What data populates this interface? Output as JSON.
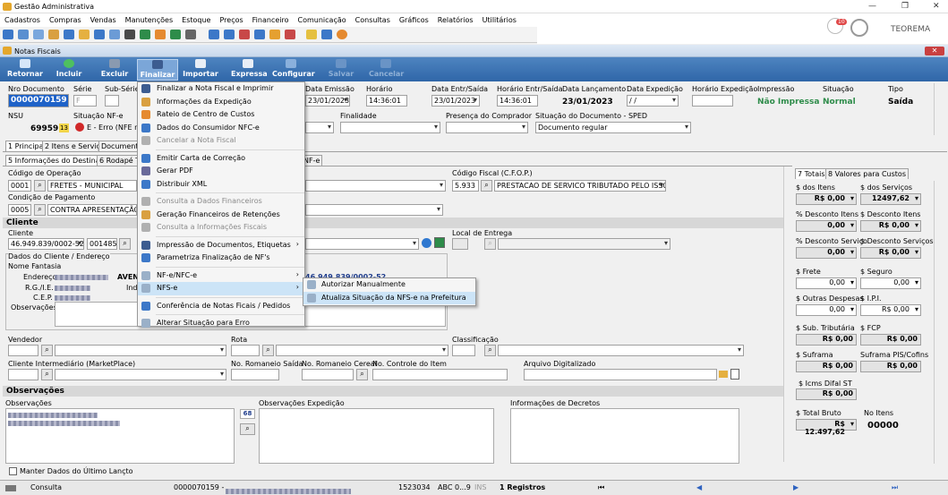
{
  "app": {
    "title": "Gestão Administrativa",
    "user": "TEOREMA",
    "notif_count": "10"
  },
  "menubar": [
    "Cadastros",
    "Compras",
    "Vendas",
    "Manutenções",
    "Estoque",
    "Preços",
    "Financeiro",
    "Comunicação",
    "Consultas",
    "Gráficos",
    "Relatórios",
    "Utilitários",
    "Ajuda",
    "Janelas"
  ],
  "window": {
    "title": "Notas Fiscais"
  },
  "ribbon": {
    "retornar": "Retornar",
    "incluir": "Incluir",
    "excluir": "Excluir",
    "finalizar": "Finalizar",
    "importar": "Importar",
    "expressa": "Expressa",
    "configurar": "Configurar",
    "salvar": "Salvar",
    "cancelar": "Cancelar"
  },
  "header": {
    "nro_label": "Nro Documento",
    "nro": "0000070159",
    "serie_label": "Série",
    "serie": "F",
    "subserie_label": "Sub-Série",
    "emissao_label": "Data Emissão",
    "emissao": "23/01/2023",
    "hora_label": "Horário",
    "hora": "14:36:01",
    "entrada_label": "Data Entr/Saída",
    "entrada": "23/01/2023",
    "hora_es_label": "Horário Entr/Saída",
    "hora_es": "14:36:01",
    "lanc_label": "Data Lançamento",
    "lanc": "23/01/2023",
    "exped_label": "Data Expedição",
    "exped": "/ /",
    "hora_exp_label": "Horário Expedição",
    "impressao_label": "Impressão",
    "impressao": "Não Impressa",
    "situacao_label": "Situação",
    "situacao": "Normal",
    "tipo_label": "Tipo",
    "tipo": "Saída",
    "nsu_label": "NSU",
    "nsu": "69959",
    "nsu_badge": "13",
    "sitnfe_label": "Situação NF-e",
    "sitnfe": "E - Erro (NFE nã",
    "finalidade_label": "Finalidade",
    "presenca_label": "Presença do Comprador",
    "sitdoc_label": "Situação do Documento - SPED",
    "sitdoc": "Documento regular"
  },
  "tabs1": [
    "1 Principal",
    "2 Itens e Serviços",
    "Documentos"
  ],
  "tabs2": [
    "5 Informações do Destinatário",
    "6 Rodapé Tra",
    "NF-e"
  ],
  "form": {
    "cod_op_label": "Código de Operação",
    "cod_op": "0001",
    "cod_op_desc": "FRETES - MUNICIPAL",
    "cfop_label": "Código Fiscal (C.F.O.P.)",
    "cfop": "5.933",
    "cfop_desc": "PRESTACAO DE SERVICO TRIBUTADO PELO ISSQN",
    "cond_label": "Condição de Pagamento",
    "cond": "0005",
    "cond_desc": "CONTRA APRESENTAÇÃO",
    "cliente_section": "Cliente",
    "cliente_label": "Cliente",
    "cliente_doc": "46.949.839/0002-52",
    "cliente_cod": "0014857",
    "local_label": "Local de Entrega",
    "dados_label": "Dados do Cliente / Endereço",
    "fantasia_label": "Nome Fantasia",
    "endereco_label": "Endereço",
    "endereco": "AVEN",
    "rg_label": "R.G./I.E.",
    "ind_label": "Ind",
    "cep_label": "C.E.P.",
    "obs_label": "Observações",
    "doc_right": "46.949.839/0002-52",
    "vendedor_label": "Vendedor",
    "rota_label": "Rota",
    "class_label": "Classificação",
    "interm_label": "Cliente Intermediário (MarketPlace)",
    "romaneio_label": "No. Romaneio Saída",
    "romcer_label": "No. Romaneio Cereal",
    "ctrl_label": "No. Controle do Item",
    "arquivo_label": "Arquivo Digitalizado",
    "obs_section": "Observações",
    "obs_col": "Observações",
    "obs_exp_col": "Observações Expedição",
    "decretos_col": "Informações de Decretos",
    "obs_count": "68",
    "manter": "Manter Dados do Último Lançto"
  },
  "finalizar_menu": [
    {
      "label": "Finalizar a Nota Fiscal e Imprimir",
      "dis": false
    },
    {
      "label": "Informações da Expedição",
      "dis": false
    },
    {
      "label": "Rateio de Centro de Custos",
      "dis": false
    },
    {
      "label": "Dados do Consumidor NFC-e",
      "dis": false
    },
    {
      "label": "Cancelar a Nota Fiscal",
      "dis": true
    },
    {
      "label": "Emitir Carta de Correção",
      "dis": false
    },
    {
      "label": "Gerar PDF",
      "dis": false
    },
    {
      "label": "Distribuir XML",
      "dis": false
    },
    {
      "label": "Consulta a Dados Financeiros",
      "dis": true
    },
    {
      "label": "Geração Financeiros de Retenções",
      "dis": false
    },
    {
      "label": "Consulta a Informações Fiscais",
      "dis": true
    },
    {
      "label": "Impressão de Documentos, Etiquetas",
      "dis": false
    },
    {
      "label": "Parametriza Finalização de NF's",
      "dis": false
    },
    {
      "label": "NF-e/NFC-e",
      "dis": false
    },
    {
      "label": "NFS-e",
      "dis": false
    },
    {
      "label": "Conferência de Notas Ficais / Pedidos",
      "dis": false
    },
    {
      "label": "Alterar Situação para Erro",
      "dis": false
    }
  ],
  "nfse_menu": [
    "Autorizar Manualmente",
    "Atualiza Situação da NFS-e na Prefeitura"
  ],
  "totais": {
    "tab1": "7 Totais",
    "tab2": "8 Valores para Custos",
    "dos_itens_label": "$ dos Itens",
    "dos_itens": "R$ 0,00",
    "dos_serv_label": "$ dos Serviços",
    "dos_serv": "12497,62",
    "desc_itens_label": "% Desconto Itens",
    "desc_itens": "0,00",
    "vdesc_itens_label": "$ Desconto Itens",
    "vdesc_itens": "R$ 0,00",
    "desc_serv_label": "% Desconto Serviço",
    "desc_serv": "0,00",
    "vdesc_serv_label": "$ Desconto Serviços",
    "vdesc_serv": "R$ 0,00",
    "frete_label": "$ Frete",
    "frete": "0,00",
    "seguro_label": "$ Seguro",
    "seguro": "0,00",
    "outras_label": "$ Outras Despesas",
    "outras": "0,00",
    "ipi_label": "$ I.P.I.",
    "ipi": "R$ 0,00",
    "subtrib_label": "$ Sub. Tributária",
    "subtrib": "R$ 0,00",
    "fcp_label": "$ FCP",
    "fcp": "R$ 0,00",
    "suframa_label": "$ Suframa",
    "suframa": "R$ 0,00",
    "suframapis_label": "Suframa PIS/Cofins",
    "suframapis": "R$ 0,00",
    "icms_label": "$ Icms Difal ST",
    "icms": "R$ 0,00",
    "bruto_label": "$ Total Bruto",
    "bruto": "R$ 12.497,62",
    "noitens_label": "No Itens",
    "noitens": "00000"
  },
  "status": {
    "mode": "Consulta",
    "doc": "0000070159 -",
    "num": "1523034",
    "abc": "ABC",
    "range": "0...9",
    "ins": "INS",
    "regs": "1 Registros"
  }
}
